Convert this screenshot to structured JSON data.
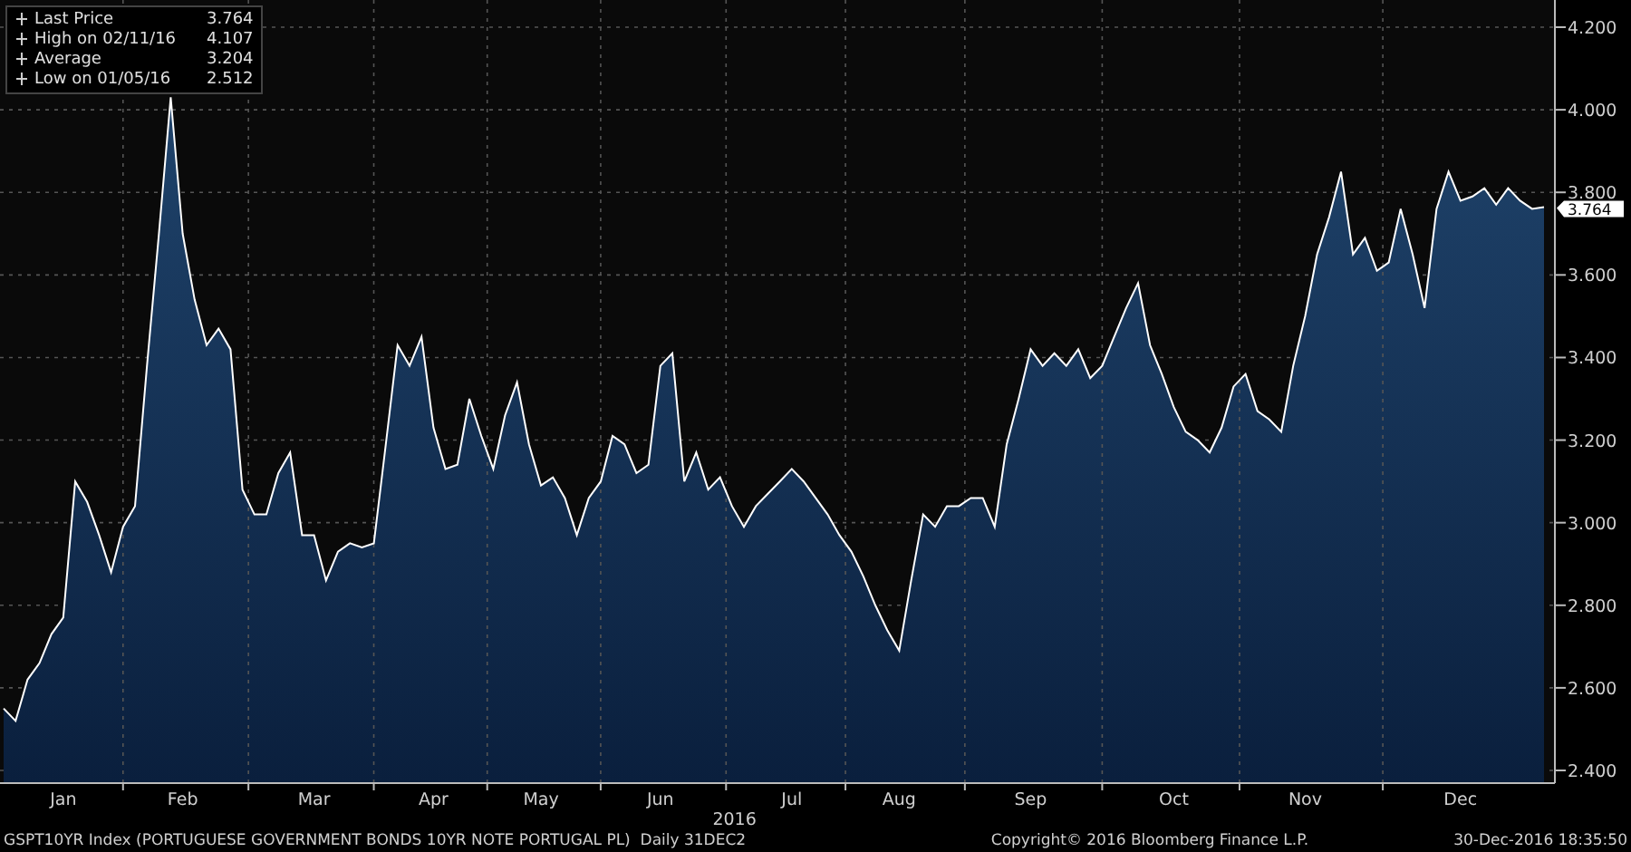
{
  "legend": [
    {
      "label": "Last Price",
      "value": "3.764"
    },
    {
      "label": "High on 02/11/16",
      "value": "4.107"
    },
    {
      "label": "Average",
      "value": "3.204"
    },
    {
      "label": "Low on 01/05/16",
      "value": "2.512"
    }
  ],
  "last_value_tag": "3.764",
  "year_label": "2016",
  "chart_data": {
    "type": "area",
    "grid": true,
    "ylim": [
      2.4,
      4.2
    ],
    "yticks": [
      {
        "value": 2.4,
        "label": "2.400"
      },
      {
        "value": 2.6,
        "label": "2.600"
      },
      {
        "value": 2.8,
        "label": "2.800"
      },
      {
        "value": 3.0,
        "label": "3.000"
      },
      {
        "value": 3.2,
        "label": "3.200"
      },
      {
        "value": 3.4,
        "label": "3.400"
      },
      {
        "value": 3.6,
        "label": "3.600"
      },
      {
        "value": 3.8,
        "label": "3.800"
      },
      {
        "value": 4.0,
        "label": "4.000"
      },
      {
        "value": 4.2,
        "label": "4.200"
      }
    ],
    "categories": [
      null,
      null,
      null,
      null,
      null,
      "Jan",
      null,
      null,
      null,
      null,
      null,
      null,
      null,
      null,
      null,
      "Feb",
      null,
      null,
      null,
      null,
      null,
      null,
      null,
      null,
      null,
      null,
      "Mar",
      null,
      null,
      null,
      null,
      null,
      null,
      null,
      null,
      null,
      "Apr",
      null,
      null,
      null,
      null,
      null,
      null,
      null,
      null,
      "May",
      null,
      null,
      null,
      null,
      null,
      null,
      null,
      null,
      null,
      "Jun",
      null,
      null,
      null,
      null,
      null,
      null,
      null,
      null,
      null,
      null,
      "Jul",
      null,
      null,
      null,
      null,
      null,
      null,
      null,
      null,
      "Aug",
      null,
      null,
      null,
      null,
      null,
      null,
      null,
      null,
      null,
      null,
      "Sep",
      null,
      null,
      null,
      null,
      null,
      null,
      null,
      null,
      null,
      null,
      null,
      "Oct",
      null,
      null,
      null,
      null,
      null,
      null,
      null,
      null,
      null,
      null,
      "Nov",
      null,
      null,
      null,
      null,
      null,
      null,
      null,
      null,
      null,
      null,
      null,
      null,
      "Dec",
      null,
      null,
      null,
      null,
      null,
      null,
      null
    ],
    "series": [
      {
        "color": "#ffffff",
        "values": [
          2.55,
          2.52,
          2.62,
          2.66,
          2.73,
          2.77,
          3.1,
          3.05,
          2.97,
          2.88,
          2.99,
          3.04,
          3.38,
          3.7,
          4.03,
          3.7,
          3.54,
          3.43,
          3.47,
          3.42,
          3.08,
          3.02,
          3.02,
          3.12,
          3.17,
          2.97,
          2.97,
          2.86,
          2.93,
          2.95,
          2.94,
          2.95,
          3.19,
          3.43,
          3.38,
          3.45,
          3.23,
          3.13,
          3.14,
          3.3,
          3.21,
          3.13,
          3.26,
          3.34,
          3.19,
          3.09,
          3.11,
          3.06,
          2.97,
          3.06,
          3.1,
          3.21,
          3.19,
          3.12,
          3.14,
          3.38,
          3.41,
          3.1,
          3.17,
          3.08,
          3.11,
          3.04,
          2.99,
          3.04,
          3.07,
          3.1,
          3.13,
          3.1,
          3.06,
          3.02,
          2.97,
          2.93,
          2.87,
          2.8,
          2.74,
          2.69,
          2.86,
          3.02,
          2.99,
          3.04,
          3.04,
          3.06,
          3.06,
          2.99,
          3.19,
          3.3,
          3.42,
          3.38,
          3.41,
          3.38,
          3.42,
          3.35,
          3.38,
          3.45,
          3.52,
          3.58,
          3.43,
          3.36,
          3.28,
          3.22,
          3.2,
          3.17,
          3.23,
          3.33,
          3.36,
          3.27,
          3.25,
          3.22,
          3.38,
          3.5,
          3.65,
          3.74,
          3.85,
          3.65,
          3.69,
          3.61,
          3.63,
          3.76,
          3.65,
          3.52,
          3.76,
          3.85,
          3.78,
          3.79,
          3.81,
          3.77,
          3.81,
          3.78,
          3.76,
          3.764
        ]
      }
    ]
  },
  "footer": {
    "description": "GSPT10YR Index (PORTUGUESE GOVERNMENT BONDS 10YR NOTE PORTUGAL PL)  Daily 31DEC2",
    "copyright": "Copyright© 2016 Bloomberg Finance L.P.",
    "timestamp": "30-Dec-2016 18:35:50"
  }
}
